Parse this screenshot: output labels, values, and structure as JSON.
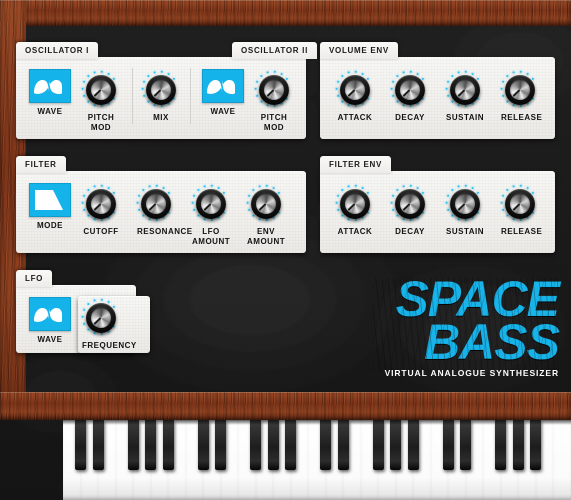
{
  "app": {
    "name": "Space Bass",
    "accent_color": "#14b4eb",
    "wood_color": "#7e3418",
    "panel_color": "#f3f1ee",
    "background_color": "#1a1a1a"
  },
  "logo": {
    "line1": "SPACE",
    "line2": "BASS",
    "subtitle": "VIRTUAL ANALOGUE SYNTHESIZER"
  },
  "panels": [
    {
      "id": "oscillator-1",
      "tab_label": "OSCILLATOR I",
      "controls": [
        {
          "name": "wave",
          "label": "WAVE",
          "type": "wave-icon",
          "icon": "sine-wave-icon"
        },
        {
          "name": "pitch-mod",
          "label": "PITCH\nMOD",
          "type": "knob",
          "icon": "knob-icon",
          "angle": 225
        }
      ]
    },
    {
      "id": "oscillator-mix",
      "tab_label": "",
      "controls": [
        {
          "name": "mix",
          "label": "MIX",
          "type": "knob",
          "icon": "knob-icon",
          "angle": 225
        }
      ]
    },
    {
      "id": "oscillator-2",
      "tab_label": "OSCILLATOR II",
      "controls": [
        {
          "name": "wave",
          "label": "WAVE",
          "type": "wave-icon",
          "icon": "sine-wave-icon"
        },
        {
          "name": "pitch-mod",
          "label": "PITCH\nMOD",
          "type": "knob",
          "icon": "knob-icon",
          "angle": 225
        }
      ]
    },
    {
      "id": "volume-env",
      "tab_label": "VOLUME ENV",
      "controls": [
        {
          "name": "attack",
          "label": "ATTACK",
          "type": "knob",
          "icon": "knob-icon",
          "angle": 225
        },
        {
          "name": "decay",
          "label": "DECAY",
          "type": "knob",
          "icon": "knob-icon",
          "angle": 225
        },
        {
          "name": "sustain",
          "label": "SUSTAIN",
          "type": "knob",
          "icon": "knob-icon",
          "angle": 225
        },
        {
          "name": "release",
          "label": "RELEASE",
          "type": "knob",
          "icon": "knob-icon",
          "angle": 225
        }
      ]
    },
    {
      "id": "filter",
      "tab_label": "FILTER",
      "controls": [
        {
          "name": "mode",
          "label": "MODE",
          "type": "wave-icon",
          "icon": "lowpass-filter-icon"
        },
        {
          "name": "cutoff",
          "label": "CUTOFF",
          "type": "knob",
          "icon": "knob-icon",
          "angle": 225
        },
        {
          "name": "resonance",
          "label": "RESONANCE",
          "type": "knob",
          "icon": "knob-icon",
          "angle": 225
        },
        {
          "name": "lfo-amount",
          "label": "LFO\nAMOUNT",
          "type": "knob",
          "icon": "knob-icon",
          "angle": 225
        },
        {
          "name": "env-amount",
          "label": "ENV\nAMOUNT",
          "type": "knob",
          "icon": "knob-icon",
          "angle": 225
        }
      ]
    },
    {
      "id": "filter-env",
      "tab_label": "FILTER ENV",
      "controls": [
        {
          "name": "attack",
          "label": "ATTACK",
          "type": "knob",
          "icon": "knob-icon",
          "angle": 225
        },
        {
          "name": "decay",
          "label": "DECAY",
          "type": "knob",
          "icon": "knob-icon",
          "angle": 225
        },
        {
          "name": "sustain",
          "label": "SUSTAIN",
          "type": "knob",
          "icon": "knob-icon",
          "angle": 225
        },
        {
          "name": "release",
          "label": "RELEASE",
          "type": "knob",
          "icon": "knob-icon",
          "angle": 225
        }
      ]
    },
    {
      "id": "lfo",
      "tab_label": "LFO",
      "controls": [
        {
          "name": "wave",
          "label": "WAVE",
          "type": "wave-icon",
          "icon": "sine-wave-icon"
        },
        {
          "name": "frequency",
          "label": "FREQUENCY",
          "type": "knob",
          "icon": "knob-icon",
          "angle": 225
        }
      ]
    }
  ],
  "keyboard": {
    "white_key_count": 29,
    "octaves": 4,
    "start_note": "C"
  }
}
